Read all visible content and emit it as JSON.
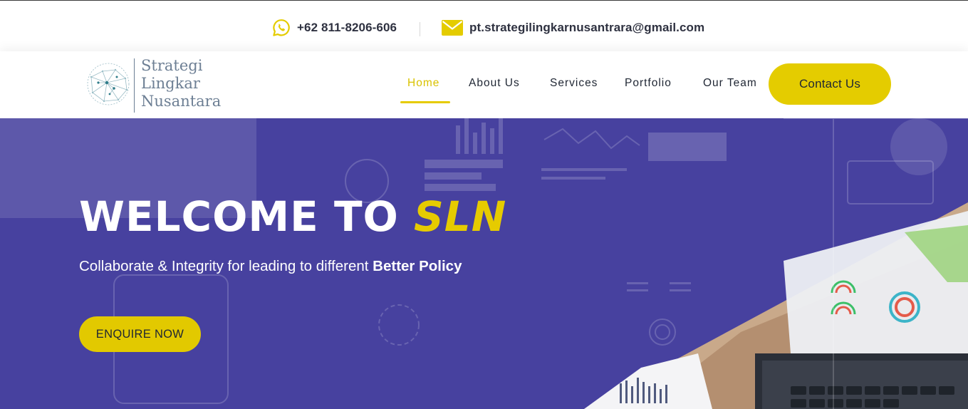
{
  "topbar": {
    "phone": {
      "icon": "whatsapp-icon",
      "text": "+62 811-8206-606"
    },
    "email": {
      "icon": "envelope-icon",
      "text": "pt.strategilingkarnusantrara@gmail.com"
    }
  },
  "logo": {
    "icon": "network-globe-icon",
    "lines": [
      "Strategi",
      "Lingkar",
      "Nusantara"
    ]
  },
  "nav": {
    "items": [
      {
        "label": "Home",
        "active": true
      },
      {
        "label": "About Us",
        "active": false
      },
      {
        "label": "Services",
        "active": false
      },
      {
        "label": "Portfolio",
        "active": false
      },
      {
        "label": "Our Team",
        "active": false
      }
    ],
    "cta": "Contact Us"
  },
  "hero": {
    "title_prefix": "WELCOME TO ",
    "title_accent": "SLN",
    "subtitle_prefix": "Collaborate & Integrity for leading to different ",
    "subtitle_bold": "Better Policy",
    "button": "ENQUIRE NOW"
  },
  "colors": {
    "accent": "#e4cc00",
    "hero_overlay": "#47419f",
    "text_dark": "#1f2633",
    "logo_text": "#6d7f94"
  }
}
